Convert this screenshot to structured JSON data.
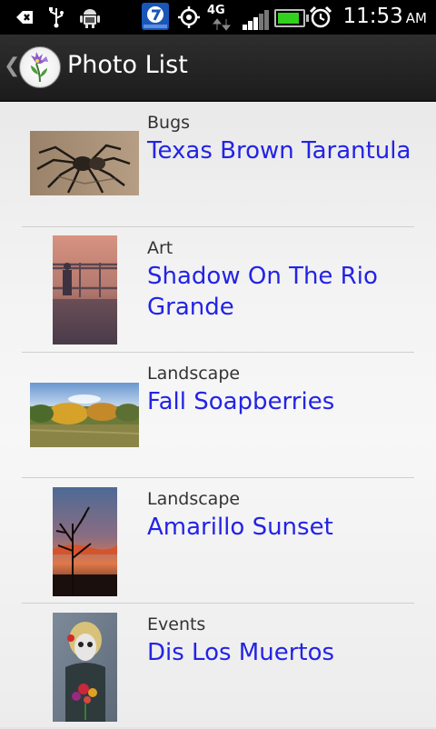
{
  "status_bar": {
    "network_label": "4G",
    "clock_time": "11:53",
    "clock_ampm": "AM",
    "signal_bars": 3,
    "signal_max": 5,
    "battery_level": 0.9,
    "battery_color": "#33d11f",
    "icons": [
      "usb-debug-icon",
      "usb-icon",
      "android-icon",
      "news-app-icon",
      "gps-icon",
      "data-arrows-icon",
      "signal-icon",
      "battery-icon",
      "alarm-clock-icon"
    ]
  },
  "action_bar": {
    "back_glyph": "❮",
    "title": "Photo List",
    "logo_icon": "flower-logo-icon"
  },
  "accent_color": "#2323e6",
  "photos": [
    {
      "category": "Bugs",
      "title": "Texas Brown Tarantula",
      "thumb_icon": "tarantula-photo"
    },
    {
      "category": "Art",
      "title": "Shadow On The Rio Grande",
      "thumb_icon": "shadow-photo"
    },
    {
      "category": "Landscape",
      "title": "Fall Soapberries",
      "thumb_icon": "soapberries-photo"
    },
    {
      "category": "Landscape",
      "title": "Amarillo Sunset",
      "thumb_icon": "sunset-photo"
    },
    {
      "category": "Events",
      "title": "Dis Los Muertos",
      "thumb_icon": "muertos-photo"
    }
  ]
}
